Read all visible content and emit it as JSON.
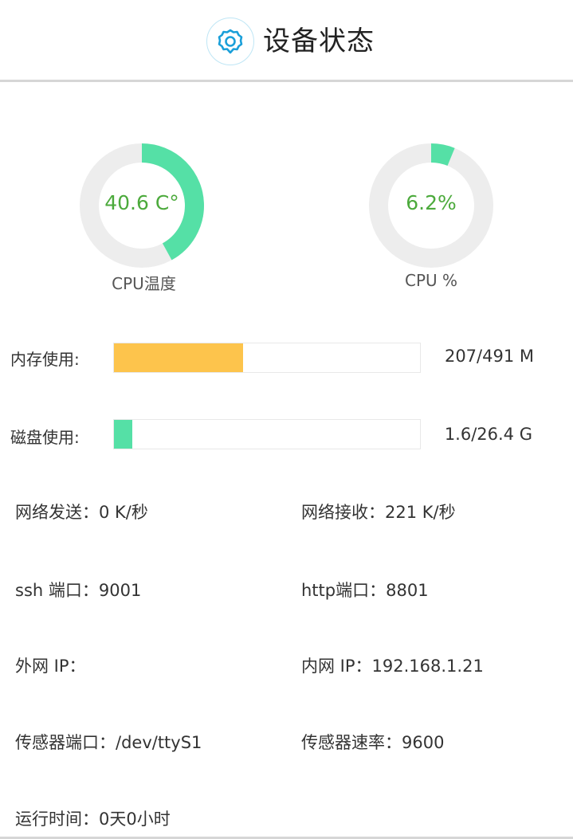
{
  "header": {
    "title": "设备状态",
    "icon": "gear-icon",
    "icon_color": "#1a9fd9"
  },
  "gauges": [
    {
      "label": "CPU温度",
      "value": "40.6 C°",
      "fraction": 0.42,
      "color": "#55e0a6"
    },
    {
      "label": "CPU %",
      "value": "6.2%",
      "fraction": 0.062,
      "color": "#55e0a6"
    }
  ],
  "memory": {
    "label": "内存使用:",
    "value": "207/491 M",
    "fraction": 0.4216,
    "color": "#fdc44c"
  },
  "disk": {
    "label": "磁盘使用:",
    "value": "1.6/26.4 G",
    "fraction": 0.0606,
    "color": "#55e0a6"
  },
  "info": {
    "net_send": "网络发送：0 K/秒",
    "net_recv": "网络接收：221 K/秒",
    "ssh_port": "ssh 端口：9001",
    "http_port": "http端口：8801",
    "wan_ip": "外网 IP：",
    "lan_ip": "内网 IP：192.168.1.21",
    "sensor_port": "传感器端口：/dev/ttyS1",
    "sensor_rate": "传感器速率：9600",
    "uptime": "运行时间：0天0小时"
  }
}
